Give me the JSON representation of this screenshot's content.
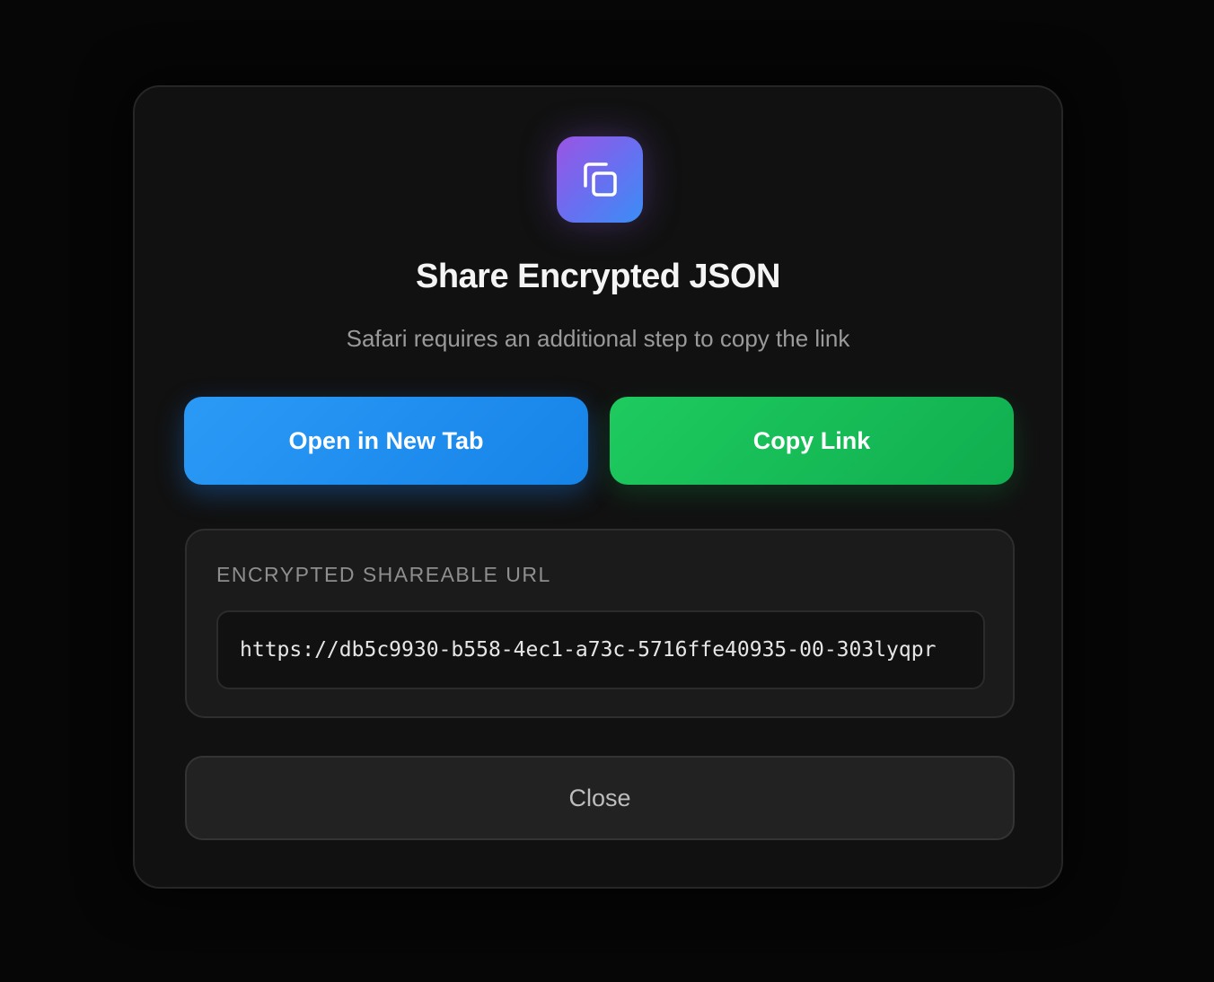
{
  "dialog": {
    "icon": "copy-icon",
    "title": "Share Encrypted JSON",
    "subtitle": "Safari requires an additional step to copy the link"
  },
  "actions": {
    "open_label": "Open in New Tab",
    "copy_label": "Copy Link",
    "close_label": "Close"
  },
  "url_panel": {
    "label": "ENCRYPTED SHAREABLE URL",
    "value": "https://db5c9930-b558-4ec1-a73c-5716ffe40935-00-303lyqpr"
  },
  "colors": {
    "background": "#070707",
    "modal_background": "#111111",
    "icon_gradient_start": "#9a55e4",
    "icon_gradient_end": "#3a8ef5",
    "open_button": "#1e8ff0",
    "copy_button": "#16bd57",
    "close_button": "#222222"
  }
}
